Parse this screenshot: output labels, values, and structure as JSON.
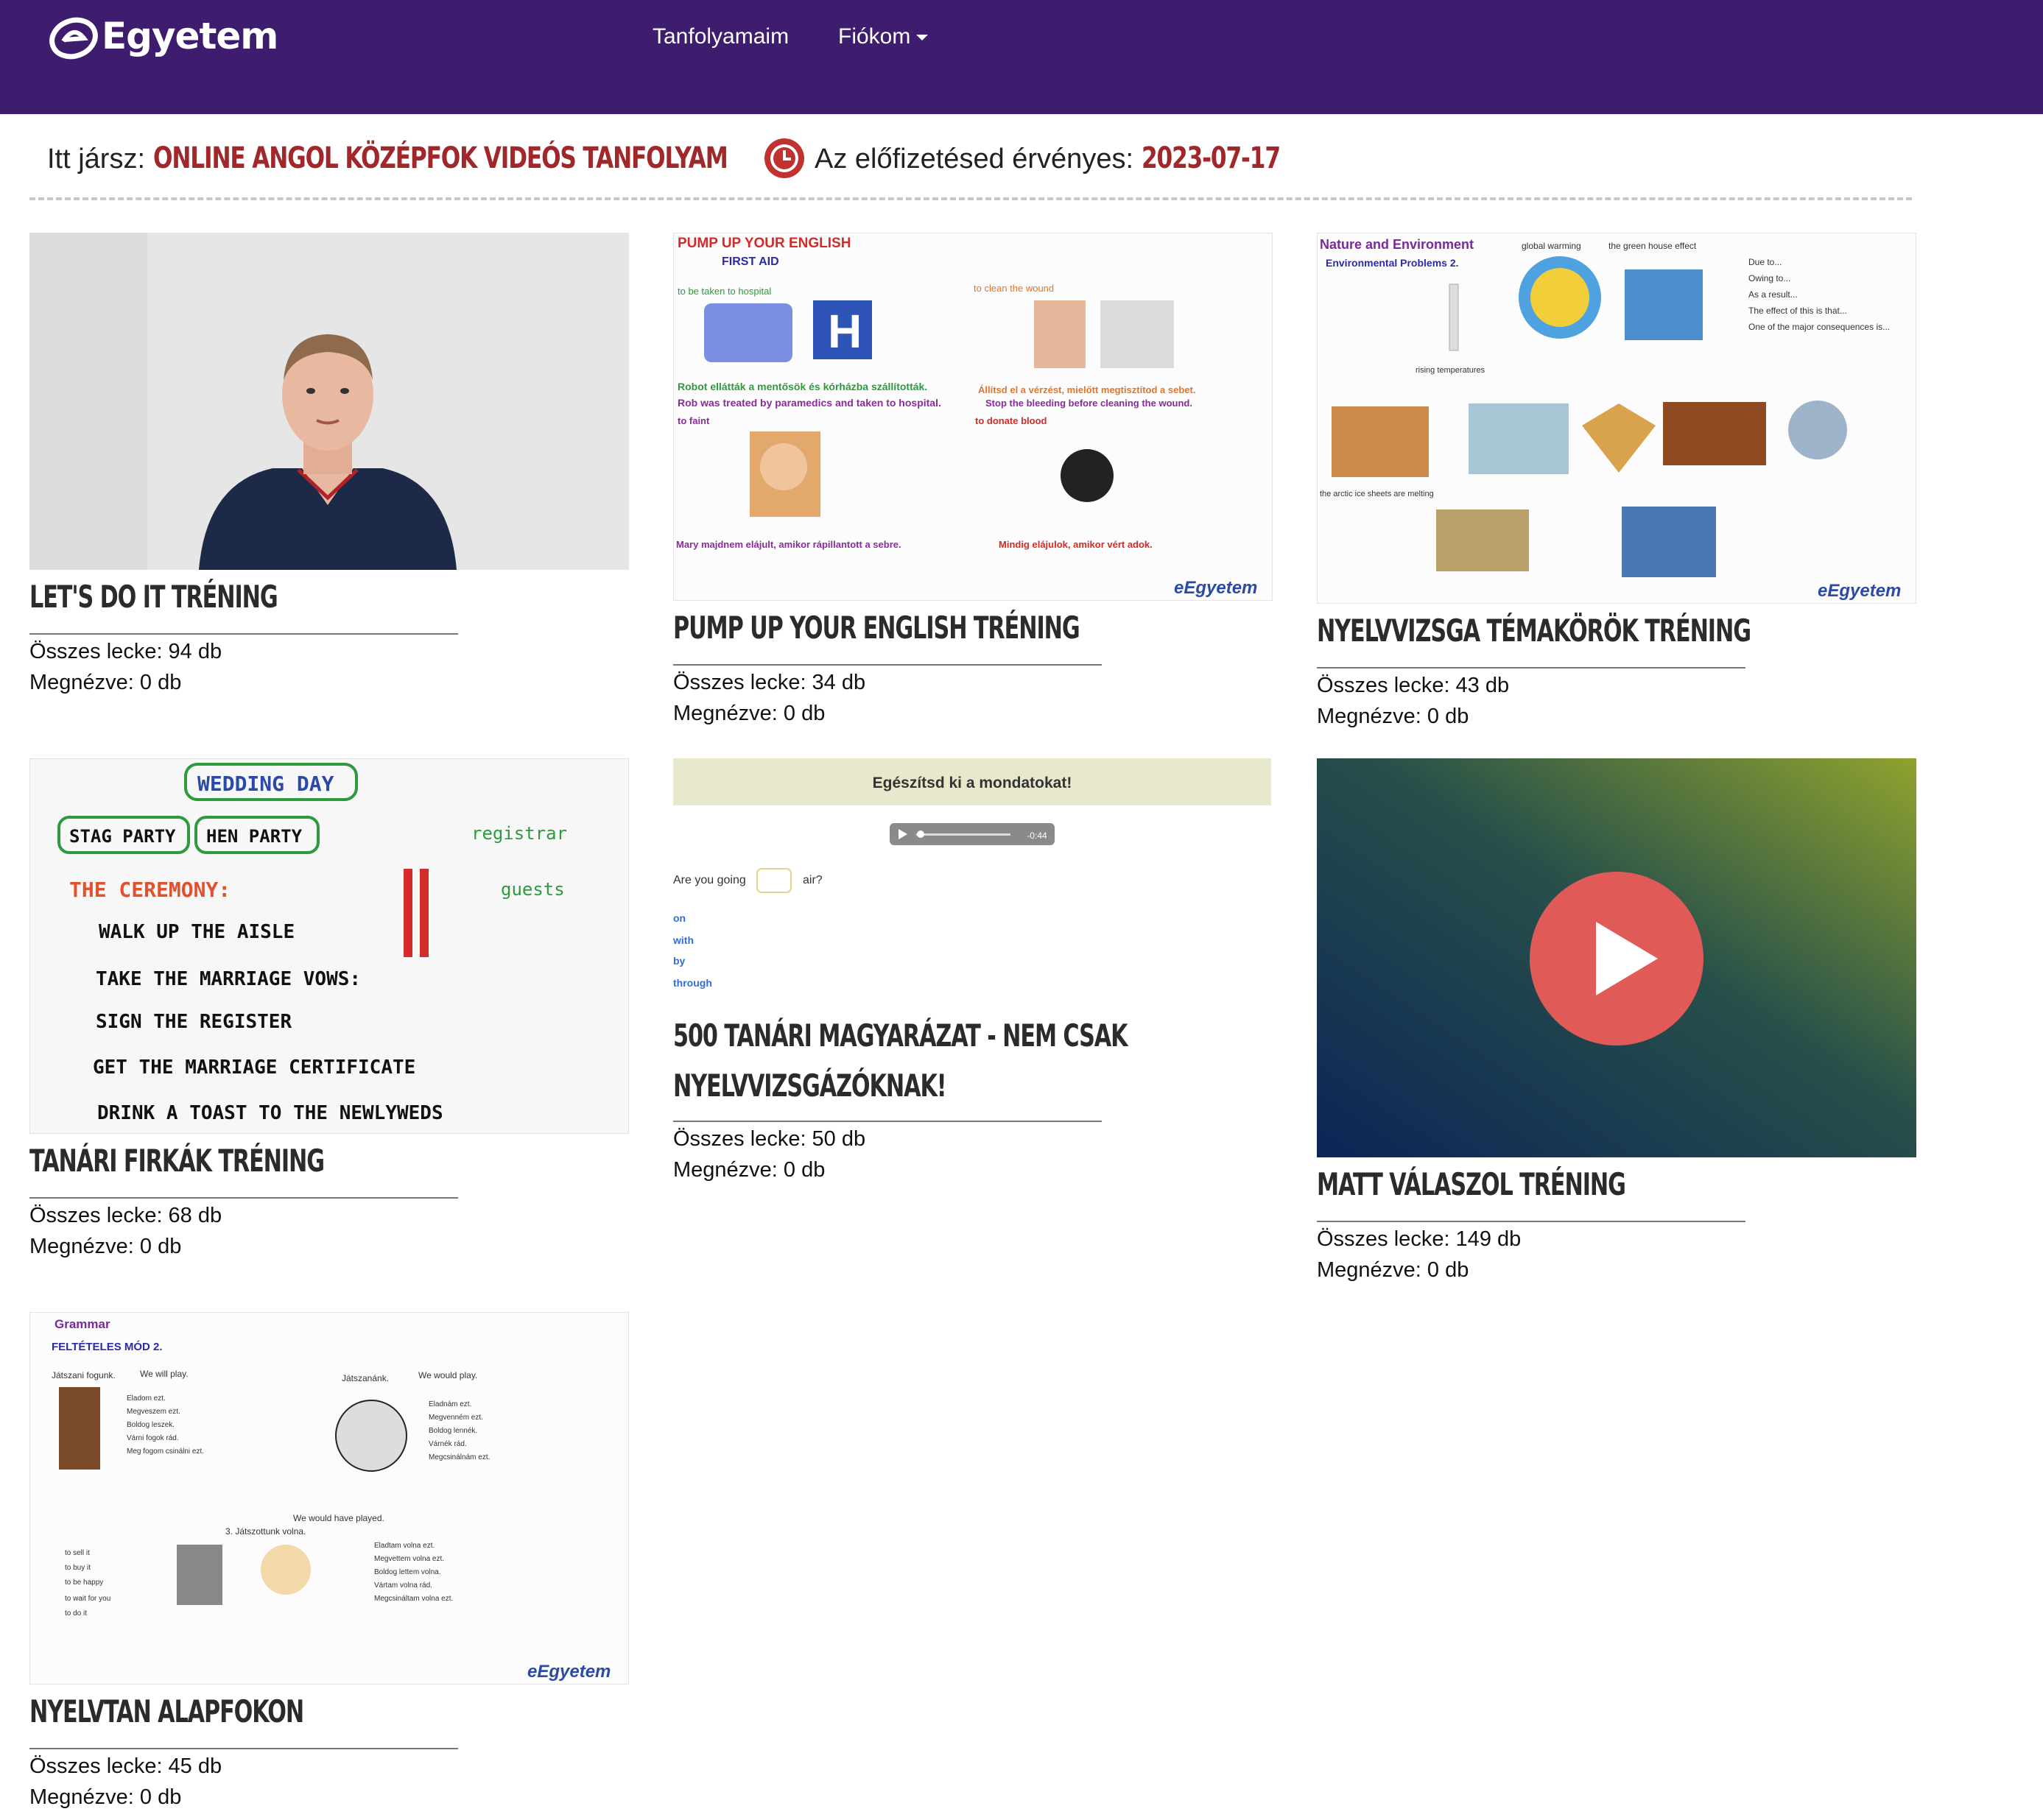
{
  "header": {
    "logo_text": "Egyetem",
    "nav": [
      {
        "label": "Tanfolyamaim"
      },
      {
        "label": "Fiókom"
      }
    ]
  },
  "status": {
    "location_label": "Itt jársz:",
    "location_value": "ONLINE ANGOL KÖZÉPFOK VIDEÓS TANFOLYAM",
    "subscription_label": "Az előfizetésed érvényes:",
    "subscription_value": "2023-07-17"
  },
  "courses": [
    {
      "title": "LET'S DO IT TRÉNING",
      "total": "Összes lecke: 94 db",
      "watched": "Megnézve: 0 db"
    },
    {
      "title": "PUMP UP YOUR ENGLISH TRÉNING",
      "total": "Összes lecke: 34 db",
      "watched": "Megnézve: 0 db",
      "thumb": {
        "heading": "PUMP UP YOUR ENGLISH",
        "sub": "FIRST AID",
        "line1": "to be taken to hospital",
        "line2": "to clean the wound",
        "line3": "Robot ellátták a mentősök és kórházba szállították.",
        "line4": "Rob was treated by paramedics and taken to hospital.",
        "line5": "Állítsd el a vérzést, mielőtt megtisztítod a sebet.",
        "line6": "Stop the bleeding before cleaning the wound.",
        "line7": "to faint",
        "line8": "to donate blood",
        "line9": "Mary majdnem elájult, amikor rápillantott a sebre.",
        "line10": "Mindig elájulok, amikor vért adok.",
        "brand": "eEgyetem"
      }
    },
    {
      "title": "NYELVVIZSGA TÉMAKÖRÖK TRÉNING",
      "total": "Összes lecke: 43 db",
      "watched": "Megnézve: 0 db",
      "thumb": {
        "heading": "Nature and Environment",
        "sub": "Environmental Problems 2.",
        "tag1": "global warming",
        "tag2": "the green house effect",
        "list": [
          "Due to...",
          "Owing to...",
          "As a result...",
          "The effect of this is that...",
          "One of the major consequences is..."
        ],
        "caption1": "rising temperatures",
        "caption2": "the arctic ice sheets are melting",
        "brand": "eEgyetem"
      }
    },
    {
      "title": "TANÁRI FIRKÁK TRÉNING",
      "total": "Összes lecke: 68 db",
      "watched": "Megnézve: 0 db",
      "thumb": {
        "heading": "WEDDING DAY",
        "tag1": "STAG PARTY",
        "tag2": "HEN PARTY",
        "section": "THE CEREMONY:",
        "lines": [
          "WALK UP THE AISLE",
          "TAKE THE MARRIAGE VOWS:",
          "SIGN THE REGISTER",
          "GET THE MARRIAGE CERTIFICATE",
          "DRINK A TOAST TO THE NEWLYWEDS"
        ],
        "note1": "registrar",
        "note2": "guests"
      }
    },
    {
      "title": "500 TANÁRI MAGYARÁZAT - NEM CSAK",
      "title2": "NYELVVIZSGÁZÓKNAK!",
      "total": "Összes lecke: 50 db",
      "watched": "Megnézve: 0 db",
      "thumb": {
        "banner": "Egészítsd ki a mondatokat!",
        "audio_time": "-0:44",
        "sentence_start": "Are you going",
        "sentence_end": "air?",
        "options": [
          "on",
          "with",
          "by",
          "through"
        ]
      }
    },
    {
      "title": "MATT VÁLASZOL TRÉNING",
      "total": "Összes lecke: 149 db",
      "watched": "Megnézve: 0 db"
    },
    {
      "title": "NYELVTAN ALAPFOKON",
      "total": "Összes lecke: 45 db",
      "watched": "Megnézve: 0 db",
      "thumb": {
        "heading": "Grammar",
        "sub": "FELTÉTELES MÓD 2.",
        "l1": "Játszani fogunk.",
        "l2": "We will play.",
        "l3": "Játszanánk.",
        "l4": "We would play.",
        "col1": [
          "Eladom ezt.",
          "Megveszem ezt.",
          "Boldog leszek.",
          "Várni fogok rád.",
          "Meg fogom csinálni ezt."
        ],
        "col2": [
          "Eladnám ezt.",
          "Megvenném ezt.",
          "Boldog lennék.",
          "Várnék rád.",
          "Megcsinálnám ezt."
        ],
        "l5": "We would have played.",
        "l6": "3. Játszottunk volna.",
        "col3": [
          "to sell it",
          "to buy it",
          "to be happy",
          "to wait for you",
          "to do it"
        ],
        "col4": [
          "Eladtam volna ezt.",
          "Megvettem volna ezt.",
          "Boldog lettem volna.",
          "Vártam volna rád.",
          "Megcsináltam volna ezt."
        ],
        "brand": "eEgyetem"
      }
    }
  ],
  "colors": {
    "header_bg": "#3e1c6e",
    "accent_red": "#a0282b",
    "play_red": "#e05a57"
  }
}
